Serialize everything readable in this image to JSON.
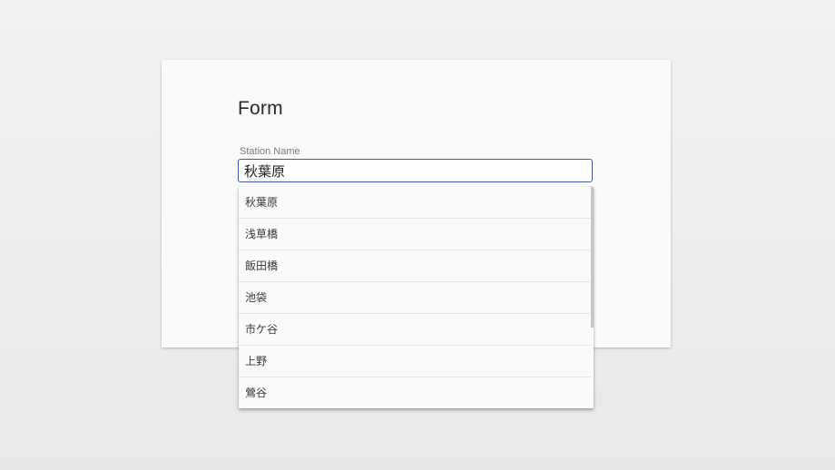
{
  "form": {
    "title": "Form",
    "station_label": "Station Name",
    "station_value": "秋葉原"
  },
  "autocomplete": {
    "options": [
      "秋葉原",
      "浅草橋",
      "飯田橋",
      "池袋",
      "市ケ谷",
      "上野",
      "鶯谷"
    ]
  }
}
